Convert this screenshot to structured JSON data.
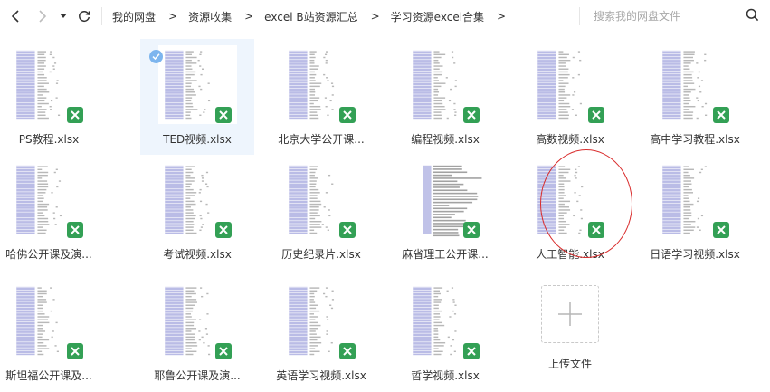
{
  "toolbar": {
    "back_icon": "chevron-left-icon",
    "forward_icon": "chevron-right-icon",
    "history_icon": "caret-down-icon",
    "refresh_icon": "refresh-icon"
  },
  "breadcrumbs": [
    {
      "label": "我的网盘"
    },
    {
      "label": "资源收集"
    },
    {
      "label": "excel B站资源汇总"
    },
    {
      "label": "学习资源excel合集"
    }
  ],
  "breadcrumb_separator": ">",
  "search": {
    "placeholder": "搜索我的网盘文件",
    "value": ""
  },
  "files": [
    {
      "name": "PS教程.xlsx",
      "thumb": "table",
      "selected": false
    },
    {
      "name": "TED视频.xlsx",
      "thumb": "table",
      "selected": true
    },
    {
      "name": "北京大学公开课...",
      "thumb": "table",
      "selected": false
    },
    {
      "name": "编程视频.xlsx",
      "thumb": "table",
      "selected": false
    },
    {
      "name": "高数视频.xlsx",
      "thumb": "table",
      "selected": false
    },
    {
      "name": "高中学习教程.xlsx",
      "thumb": "table",
      "selected": false
    },
    {
      "name": "哈佛公开课及演...",
      "thumb": "table",
      "selected": false
    },
    {
      "name": "考试视频.xlsx",
      "thumb": "table",
      "selected": false
    },
    {
      "name": "历史纪录片.xlsx",
      "thumb": "table",
      "selected": false
    },
    {
      "name": "麻省理工公开课...",
      "thumb": "dense",
      "selected": false
    },
    {
      "name": "人工智能.xlsx",
      "thumb": "table",
      "selected": false
    },
    {
      "name": "日语学习视频.xlsx",
      "thumb": "table",
      "selected": false
    },
    {
      "name": "斯坦福公开课及...",
      "thumb": "table",
      "selected": false
    },
    {
      "name": "耶鲁公开课及演...",
      "thumb": "table",
      "selected": false
    },
    {
      "name": "英语学习视频.xlsx",
      "thumb": "table",
      "selected": false
    },
    {
      "name": "哲学视频.xlsx",
      "thumb": "table",
      "selected": false
    }
  ],
  "upload": {
    "label": "上传文件",
    "icon": "plus-icon"
  },
  "file_type_icon": "excel-file-icon",
  "selected_icon": "check-circle-icon",
  "colors": {
    "accent": "#7db5ee",
    "selected_bg": "#eef5fd",
    "excel_green": "#33a055",
    "annotation_red": "#d92c2c",
    "thumb_column": "#8c8fd6"
  }
}
